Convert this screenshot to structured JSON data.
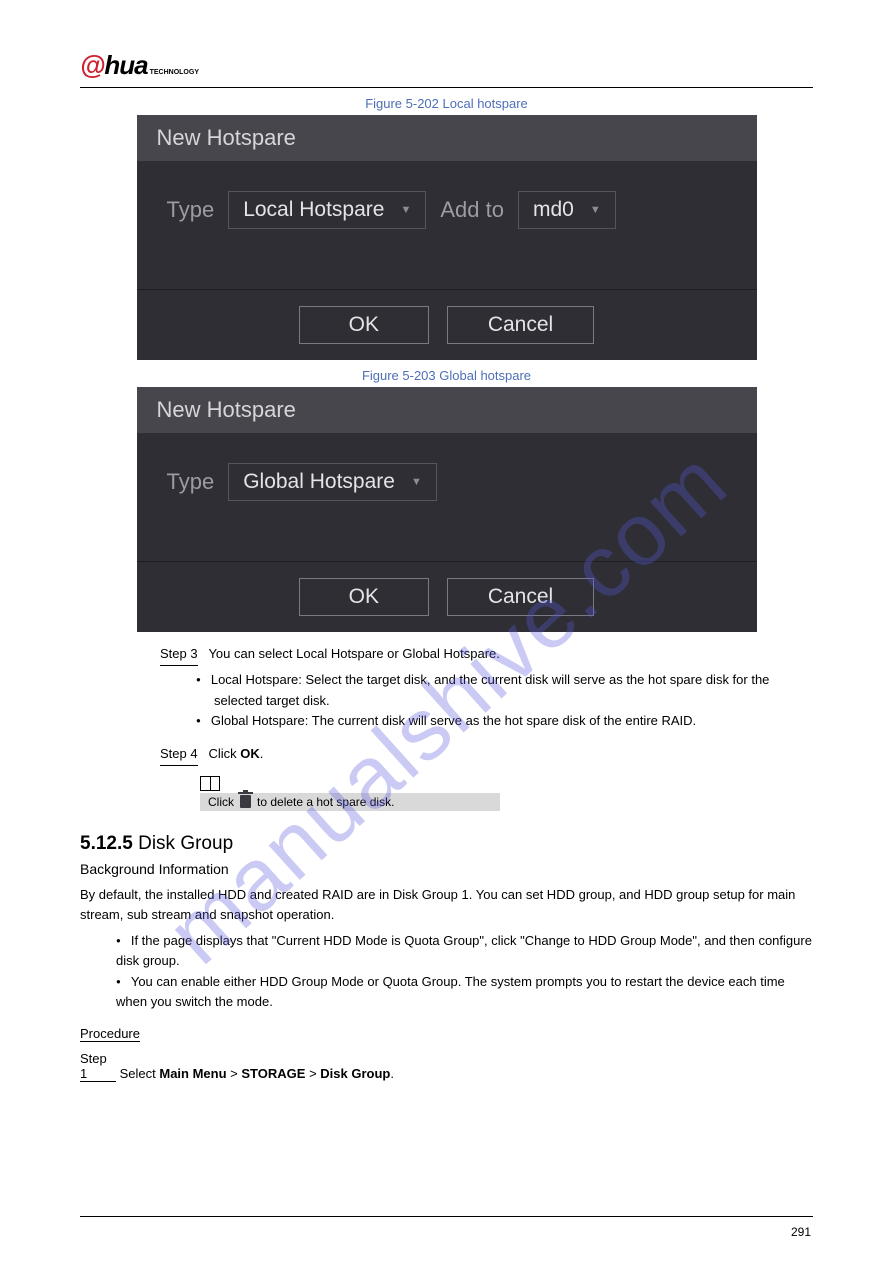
{
  "logo": {
    "part1": "@",
    "part2": "hua",
    "sub": "TECHNOLOGY"
  },
  "watermark": "manualshive.com",
  "fig1": {
    "caption": "Figure 5-202 Local hotspare",
    "title": "New Hotspare",
    "type_label": "Type",
    "type_value": "Local Hotspare",
    "addto_label": "Add to",
    "addto_value": "md0",
    "ok": "OK",
    "cancel": "Cancel"
  },
  "fig2": {
    "caption": "Figure 5-203 Global hotspare",
    "title": "New Hotspare",
    "type_label": "Type",
    "type_value": "Global Hotspare",
    "ok": "OK",
    "cancel": "Cancel"
  },
  "step3": {
    "label": "Step 3",
    "line1": "You can select Local Hotspare or Global Hotspare.",
    "b1": "Local Hotspare: Select the target disk, and the current disk will serve as the hot spare disk for the selected target disk.",
    "b2": "Global Hotspare: The current disk will serve as the hot spare disk of the entire RAID."
  },
  "step4": {
    "label": "Step 4",
    "line1_before": "Click ",
    "line1_bold": "OK",
    "line1_after": ".",
    "note_text_before": "Click ",
    "note_text_after": " to delete a hot spare disk."
  },
  "section": {
    "num": "5.12.5 ",
    "title": "Disk Group",
    "bg_title": "Background Information",
    "para1": "By default, the installed HDD and created RAID are in Disk Group 1. You can set HDD group, and HDD group setup for main stream, sub stream and snapshot operation.",
    "li1": "If the page displays that \"Current HDD Mode is Quota Group\", click \"Change to HDD Group Mode\", and then configure disk group.",
    "li2": "You can enable either HDD Group Mode or Quota Group. The system prompts you to restart the device each time when you switch the mode."
  },
  "procedure": {
    "label": "Procedure",
    "step_label": "Step 1",
    "step_text_before": "Select ",
    "step_bold1": "Main Menu",
    "sep": " > ",
    "step_bold2": "STORAGE",
    "step_bold3": "Disk Group",
    "step_after": "."
  },
  "footer": "291"
}
